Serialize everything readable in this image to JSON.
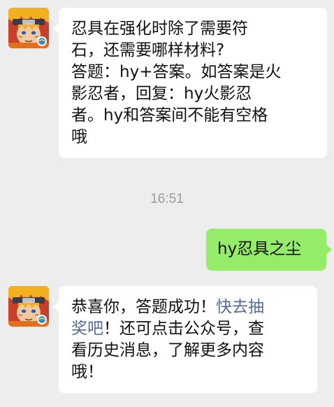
{
  "messages": [
    {
      "side": "left",
      "lines": [
        "忍具在强化时除了需要符",
        "石，还需要哪样材料?",
        "答题：hy+答案。如答案是火",
        "影忍者，回复：hy火影忍",
        "者。hy和答案间不能有空格",
        "哦"
      ]
    },
    {
      "side": "right",
      "text": "hy忍具之尘"
    },
    {
      "side": "left",
      "line1_plain": "恭喜你，答题成功！",
      "line1_link": "快去抽",
      "line2_link": "奖吧",
      "line2_plain": "！还可点击公众号，查",
      "line3": "看历史消息，了解更多内容",
      "line4": "哦！"
    }
  ],
  "timestamp": "16:51",
  "colors": {
    "background": "#ededed",
    "incoming_bubble": "#ffffff",
    "outgoing_bubble": "#95ec69",
    "link": "#576b95",
    "timestamp": "#9a9a9a"
  },
  "icons": {
    "sender_avatar": "naruto-avatar-icon"
  }
}
